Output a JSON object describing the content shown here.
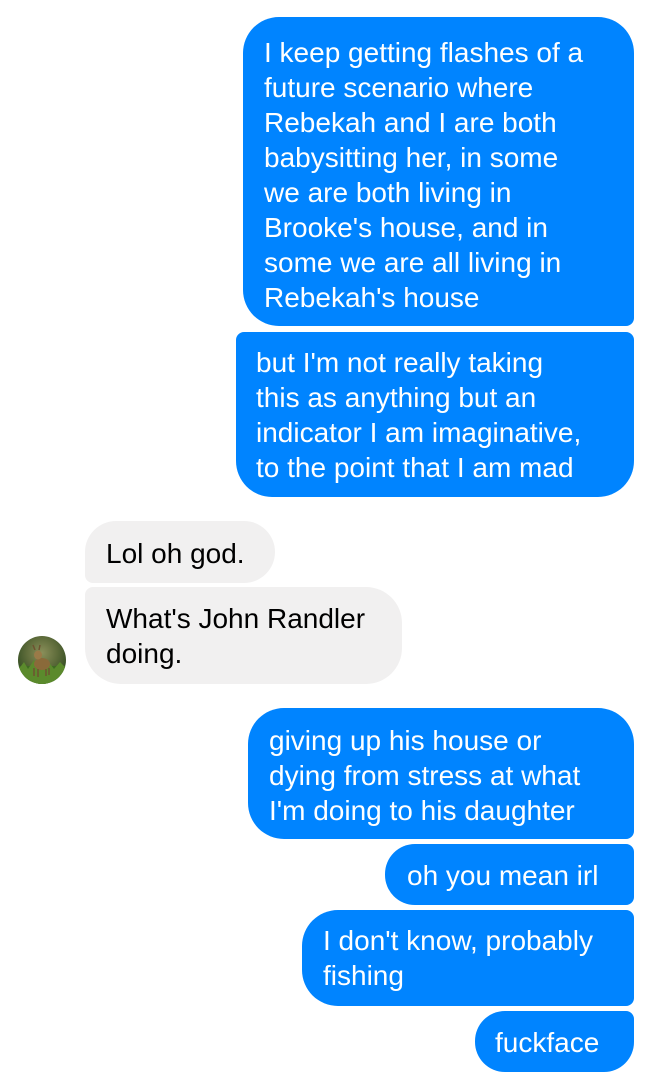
{
  "conversation": {
    "messages": [
      {
        "sender": "me",
        "text": "I keep getting flashes of a\nfuture scenario where\nRebekah and I are both\nbabysitting her, in some\nwe are both living in\nBrooke's house, and in\nsome we are all living in\nRebekah's house"
      },
      {
        "sender": "me",
        "text": "but I'm not really taking\nthis as anything but an\nindicator I am imaginative,\nto the point that I am mad"
      },
      {
        "sender": "them",
        "text": "Lol oh god."
      },
      {
        "sender": "them",
        "text": "What's John Randler\ndoing."
      },
      {
        "sender": "me",
        "text": "giving up his house or\ndying from stress at what\nI'm doing to his daughter"
      },
      {
        "sender": "me",
        "text": "oh you mean irl"
      },
      {
        "sender": "me",
        "text": "I don't know, probably\nfishing"
      },
      {
        "sender": "me",
        "text": "fuckface"
      }
    ]
  },
  "colors": {
    "outgoing_bubble": "#0084ff",
    "incoming_bubble": "#f1f0f0",
    "outgoing_text": "#ffffff",
    "incoming_text": "#000000"
  },
  "avatar": {
    "icon": "contact-avatar-photo"
  }
}
